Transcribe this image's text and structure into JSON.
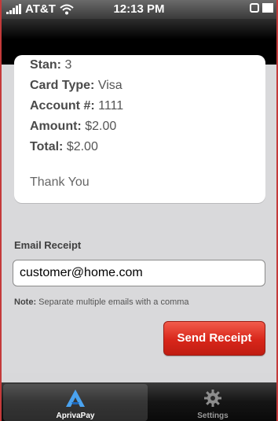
{
  "status_bar": {
    "carrier": "AT&T",
    "time": "12:13 PM",
    "icons": [
      "signal-bars-icon",
      "wifi-icon",
      "lock-icon",
      "battery-icon"
    ]
  },
  "receipt": {
    "stan_label": "Stan:",
    "stan_value": "3",
    "card_type_label": "Card Type:",
    "card_type_value": "Visa",
    "account_label": "Account #:",
    "account_value": "1111",
    "amount_label": "Amount:",
    "amount_value": "$2.00",
    "total_label": "Total:",
    "total_value": "$2.00",
    "thanks": "Thank You"
  },
  "email": {
    "label": "Email Receipt",
    "value": "customer@home.com",
    "note_label": "Note:",
    "note_text": "Separate multiple emails with a comma"
  },
  "send_button": {
    "label": "Send Receipt",
    "color": "#d8261a"
  },
  "tabs": [
    {
      "label": "AprivaPay",
      "icon": "apriva-logo-icon",
      "active": true
    },
    {
      "label": "Settings",
      "icon": "gear-icon",
      "active": false
    }
  ]
}
